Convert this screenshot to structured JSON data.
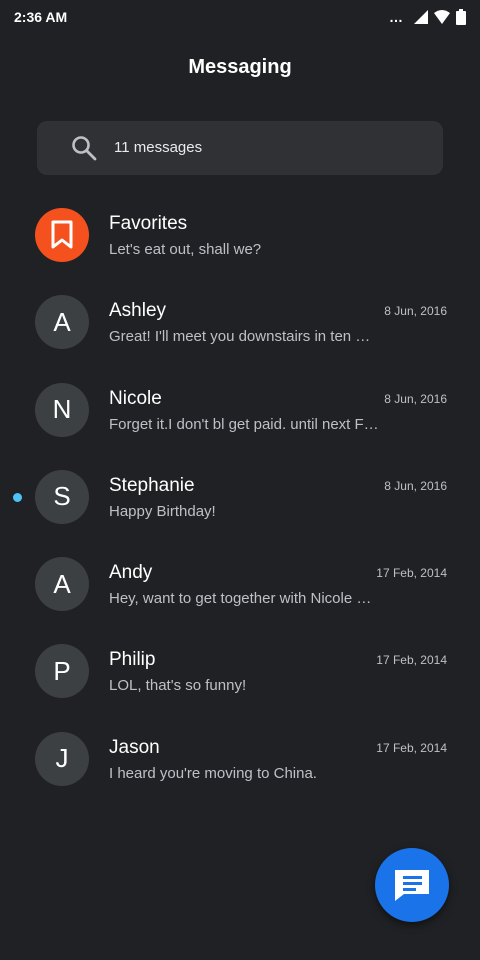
{
  "status_bar": {
    "time": "2:36 AM",
    "icons": [
      "notification-dots-icon",
      "signal-icon",
      "wifi-icon",
      "battery-icon"
    ]
  },
  "header": {
    "title": "Messaging"
  },
  "search": {
    "text": "11 messages",
    "icon": "search-icon"
  },
  "conversations": [
    {
      "name": "Favorites",
      "snippet": "Let's eat out, shall we?",
      "date": "",
      "avatar": "",
      "avatar_icon": "bookmark-icon",
      "unread": false
    },
    {
      "name": "Ashley",
      "snippet": "Great! I'll meet you downstairs in ten …",
      "date": "8 Jun, 2016",
      "avatar": "A",
      "unread": false
    },
    {
      "name": "Nicole",
      "snippet": "Forget it.I don't bl get paid. until next F…",
      "date": "8 Jun, 2016",
      "avatar": "N",
      "unread": false
    },
    {
      "name": "Stephanie",
      "snippet": "Happy Birthday!",
      "date": "8 Jun, 2016",
      "avatar": "S",
      "unread": true
    },
    {
      "name": "Andy",
      "snippet": "Hey, want to get together with Nicole …",
      "date": "17 Feb, 2014",
      "avatar": "A",
      "unread": false
    },
    {
      "name": "Philip",
      "snippet": "LOL, that's so funny!",
      "date": "17 Feb, 2014",
      "avatar": "P",
      "unread": false
    },
    {
      "name": "Jason",
      "snippet": "I heard you're moving to China.",
      "date": "17 Feb, 2014",
      "avatar": "J",
      "unread": false
    }
  ],
  "fab": {
    "icon": "new-message-icon"
  },
  "colors": {
    "background": "#202124",
    "favorites_accent": "#f4511e",
    "unread_dot": "#4fc3f7",
    "fab": "#1a73e8"
  }
}
